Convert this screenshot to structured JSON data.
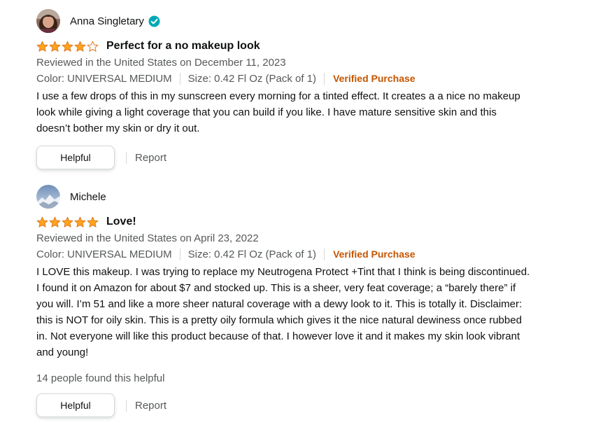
{
  "colors": {
    "star_fill": "#ffa41c",
    "star_outline": "#de7921",
    "verified": "#c45500",
    "badge": "#00a8b5",
    "text": "#0f1111",
    "muted": "#565959"
  },
  "reviews": [
    {
      "author": "Anna Singletary",
      "badge_icon": "verified-check-icon",
      "rating": 4,
      "rating_max": 5,
      "title": "Perfect for a no makeup look",
      "date_line": "Reviewed in the United States on December 11, 2023",
      "color": "Color: UNIVERSAL MEDIUM",
      "size": "Size: 0.42 Fl Oz (Pack of 1)",
      "verified": "Verified Purchase",
      "body": "I use a few drops of this in my sunscreen every morning for a tinted effect. It creates a a nice no makeup\nlook while giving a light coverage that you can build if you like. I have mature sensitive skin and this\ndoesn’t bother my skin or dry it out.",
      "helpful_count": "",
      "helpful_label": "Helpful",
      "report_label": "Report"
    },
    {
      "author": "Michele",
      "rating": 5,
      "rating_max": 5,
      "title": "Love!",
      "date_line": "Reviewed in the United States on April 23, 2022",
      "color": "Color: UNIVERSAL MEDIUM",
      "size": "Size: 0.42 Fl Oz (Pack of 1)",
      "verified": "Verified Purchase",
      "body": "I LOVE this makeup. I was trying to replace my Neutrogena Protect +Tint that I think is being discontinued.\nI found it on Amazon for about $7 and stocked up. This is a sheer, very feat coverage; a “barely there” if\nyou will. I’m 51 and like a more sheer natural coverage with a dewy look to it. This is totally it. Disclaimer:\nthis is NOT for oily skin. This is a pretty oily formula which gives it the nice natural dewiness once rubbed\nin. Not everyone will like this product because of that. I however love it and it makes my skin look vibrant\nand young!",
      "helpful_count": "14 people found this helpful",
      "helpful_label": "Helpful",
      "report_label": "Report"
    }
  ]
}
